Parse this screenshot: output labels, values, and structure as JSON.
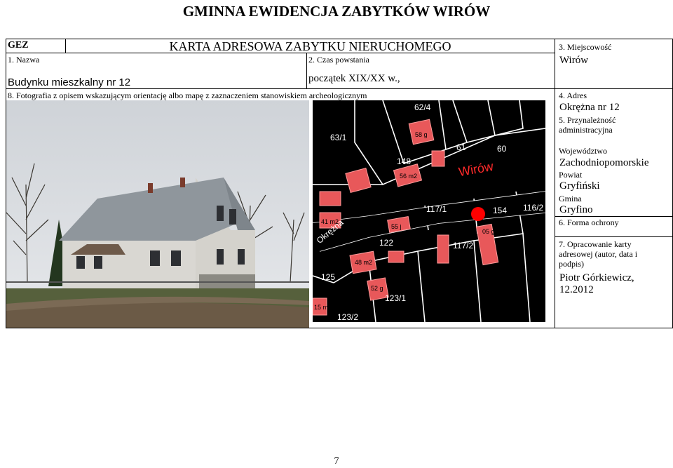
{
  "header": {
    "title": "GMINNA EWIDENCJA ZABYTKÓW WIRÓW",
    "gez": "GEZ",
    "card_title": "KARTA ADRESOWA ZABYTKU NIERUCHOMEGO"
  },
  "fields": {
    "name_label": "1. Nazwa",
    "name_value": "Budynku mieszkalny nr 12",
    "period_label": "2. Czas powstania",
    "period_value": "początek XIX/XX w.,",
    "locality_label": "3. Miejscowość",
    "locality_value": "Wirów",
    "photo_label": "8. Fotografia z opisem wskazującym orientację albo mapę z zaznaczeniem stanowiskiem archeologicznym",
    "address_label": "4. Adres",
    "address_value": "Okrężna nr 12",
    "admin_label": "5. Przynależność administracyjna",
    "voivodeship_label": "Województwo",
    "voivodeship_value": "Zachodniopomorskie",
    "county_label": "Powiat",
    "county_value": "Gryfiński",
    "commune_label": "Gmina",
    "commune_value": "Gryfino",
    "protection_label": "6. Forma ochrony",
    "author_label": "7. Opracowanie karty adresowej (autor, data i podpis)",
    "author_value": "Piotr Górkiewicz, 12.2012"
  },
  "map_labels": {
    "parcels": [
      "62/4",
      "63/1",
      "61",
      "60",
      "148",
      "117/1",
      "154",
      "116/2",
      "122",
      "117/2",
      "125",
      "123/1",
      "123/2"
    ],
    "areas": [
      "58 g",
      "56 m2",
      "55 j",
      "48 m2",
      "52 g",
      "41 m2",
      "05 g",
      "15 m"
    ],
    "town": "Wirów",
    "street": "Okrężna"
  },
  "page_number": "7",
  "colors": {
    "building_red": "#e8585a",
    "map_bg": "#000000",
    "marker": "#ff0000"
  }
}
